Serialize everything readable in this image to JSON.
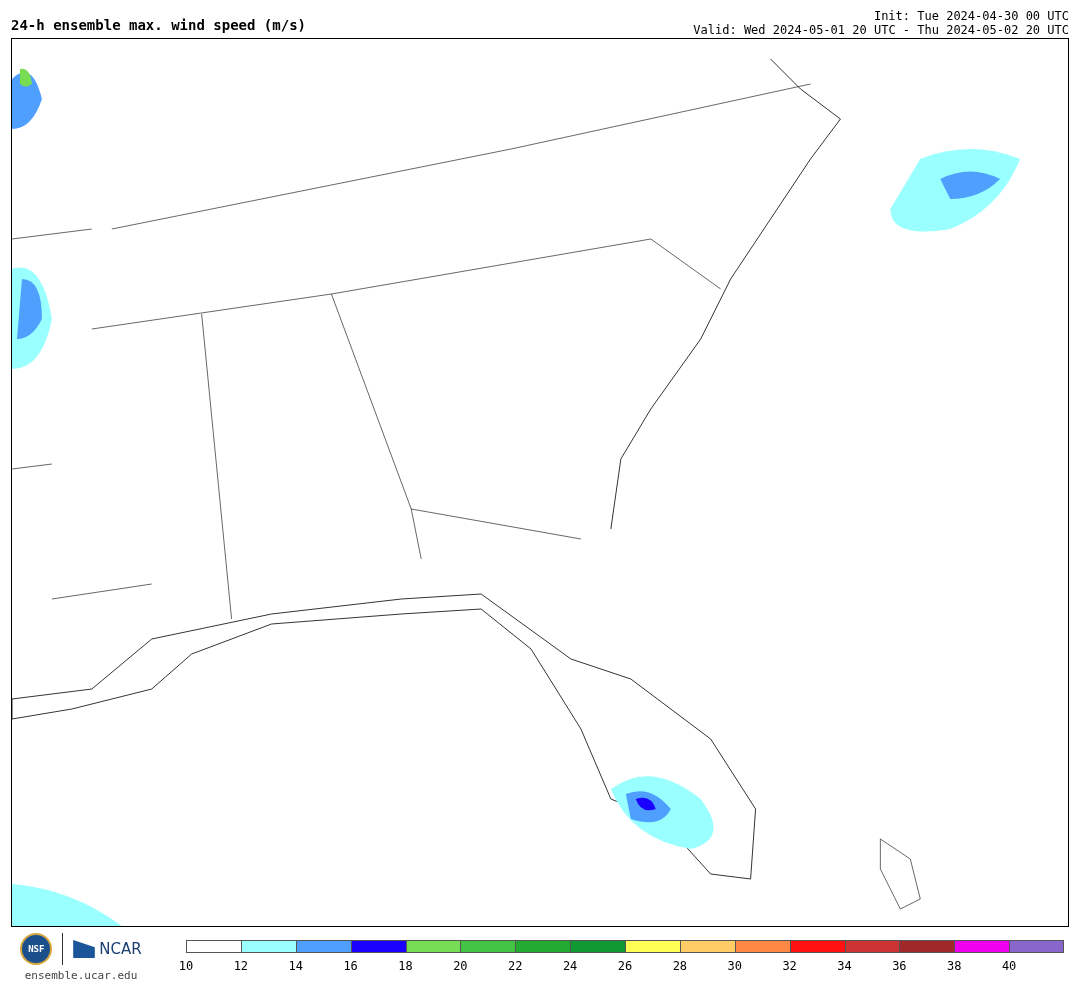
{
  "title": "24-h ensemble max. wind speed (m/s)",
  "init": "Init: Tue 2024-04-30 00 UTC",
  "valid": "Valid: Wed 2024-05-01 20 UTC - Thu 2024-05-02 20 UTC",
  "logos": {
    "nsf": "NSF",
    "ncar": "NCAR"
  },
  "url": "ensemble.ucar.edu",
  "colorbar": [
    {
      "color": "#ffffff",
      "label": "10"
    },
    {
      "color": "#99ffff",
      "label": "12"
    },
    {
      "color": "#4f9fff",
      "label": "14"
    },
    {
      "color": "#1a00ff",
      "label": "16"
    },
    {
      "color": "#77dd55",
      "label": "18"
    },
    {
      "color": "#44c444",
      "label": "20"
    },
    {
      "color": "#22aa33",
      "label": "22"
    },
    {
      "color": "#119933",
      "label": "24"
    },
    {
      "color": "#ffff55",
      "label": "26"
    },
    {
      "color": "#ffcc66",
      "label": "28"
    },
    {
      "color": "#ff8844",
      "label": "30"
    },
    {
      "color": "#ff1111",
      "label": "32"
    },
    {
      "color": "#cc3333",
      "label": "34"
    },
    {
      "color": "#a02828",
      "label": "36"
    },
    {
      "color": "#ee00ee",
      "label": "38"
    },
    {
      "color": "#8866cc",
      "label": "40"
    }
  ]
}
